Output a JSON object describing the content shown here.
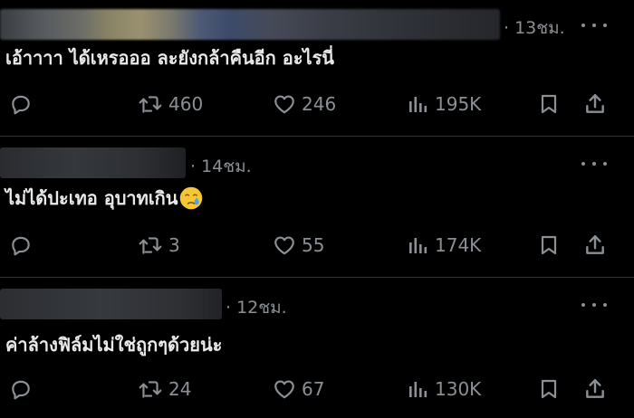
{
  "colors": {
    "background": "#000000",
    "text_primary": "#e7e9ea",
    "text_secondary": "#8b9096",
    "divider": "#2f3336"
  },
  "tweets": [
    {
      "time": "· 13ชม.",
      "text": "เอ้าาาา ได้เหรอออ ละยังกล้าคืนอีก อะไรนี่",
      "emoji": "",
      "retweets": "460",
      "likes": "246",
      "views": "195K"
    },
    {
      "time": "· 14ชม.",
      "text": "ไม่ได้ปะเทอ อุบาทเกิน",
      "emoji": "crying-face-emoji",
      "retweets": "3",
      "likes": "55",
      "views": "174K"
    },
    {
      "time": "· 12ชม.",
      "text": "ค่าล้างฟิล์มไม่ใช่ถูกๆด้วยน่ะ",
      "emoji": "",
      "retweets": "24",
      "likes": "67",
      "views": "130K"
    }
  ],
  "icons": {
    "reply": "reply-icon",
    "retweet": "retweet-icon",
    "like": "heart-icon",
    "views": "views-icon",
    "bookmark": "bookmark-icon",
    "share": "share-icon",
    "more": "more-icon"
  }
}
